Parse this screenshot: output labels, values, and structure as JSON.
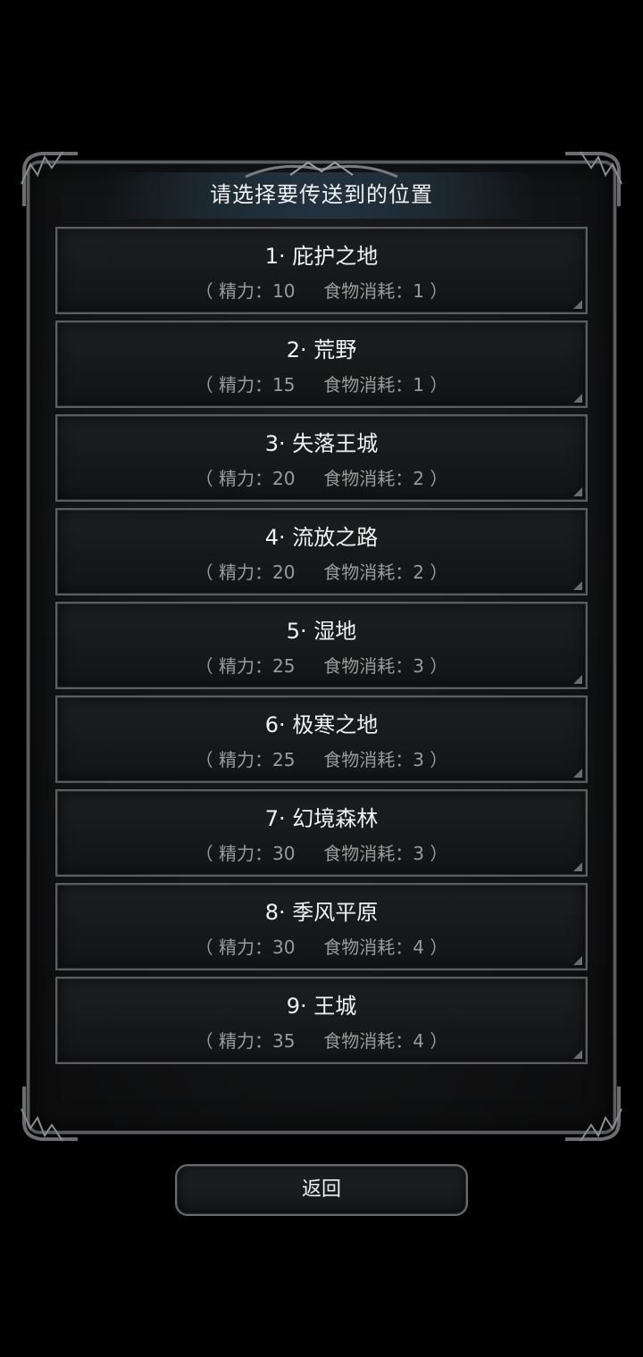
{
  "dialog": {
    "title": "请选择要传送到的位置"
  },
  "locations": [
    {
      "name": "1· 庇护之地",
      "cost": "（ 精力：10     食物消耗：1 ）"
    },
    {
      "name": "2· 荒野",
      "cost": "（ 精力：15     食物消耗：1 ）"
    },
    {
      "name": "3· 失落王城",
      "cost": "（ 精力：20     食物消耗：2 ）"
    },
    {
      "name": "4· 流放之路",
      "cost": "（ 精力：20     食物消耗：2 ）"
    },
    {
      "name": "5· 湿地",
      "cost": "（ 精力：25     食物消耗：3 ）"
    },
    {
      "name": "6· 极寒之地",
      "cost": "（ 精力：25     食物消耗：3 ）"
    },
    {
      "name": "7· 幻境森林",
      "cost": "（ 精力：30     食物消耗：3 ）"
    },
    {
      "name": "8· 季风平原",
      "cost": "（ 精力：30     食物消耗：4 ）"
    },
    {
      "name": "9· 王城",
      "cost": "（ 精力：35     食物消耗：4 ）"
    }
  ],
  "back_button": {
    "label": "返回"
  }
}
